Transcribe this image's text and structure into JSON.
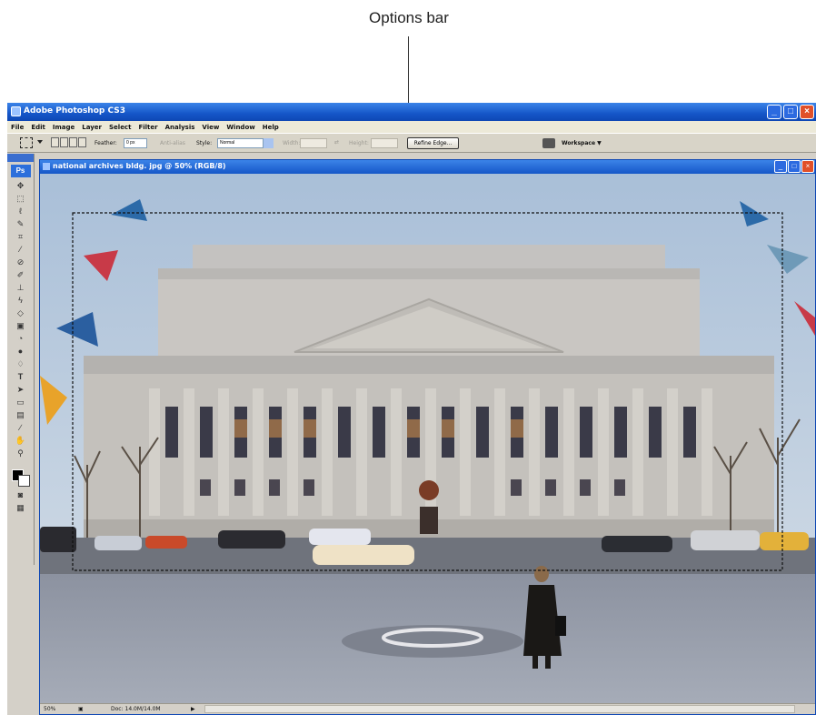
{
  "annotation": {
    "label": "Options bar"
  },
  "app": {
    "title": "Adobe Photoshop CS3"
  },
  "menu": [
    "File",
    "Edit",
    "Image",
    "Layer",
    "Select",
    "Filter",
    "Analysis",
    "View",
    "Window",
    "Help"
  ],
  "options": {
    "feather_label": "Feather:",
    "feather_value": "0 px",
    "antialias_label": "Anti-alias",
    "style_label": "Style:",
    "style_value": "Normal",
    "width_label": "Width:",
    "height_label": "Height:",
    "refine_edge": "Refine Edge...",
    "workspace": "Workspace ▼"
  },
  "toolbox": {
    "logo": "Ps"
  },
  "document": {
    "title": "national archives bldg. jpg @ 50% (RGB/8)",
    "zoom": "50%",
    "doc_size": "Doc: 14.0M/14.0M"
  }
}
